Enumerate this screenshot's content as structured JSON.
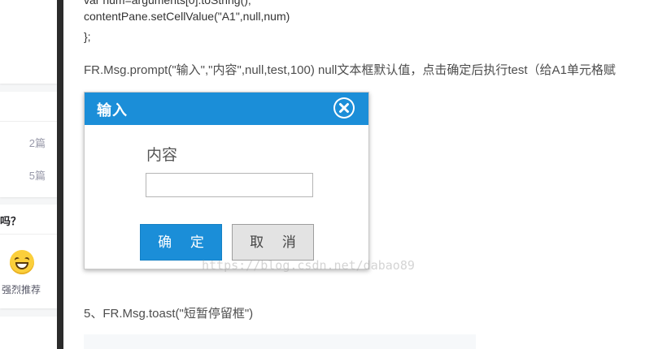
{
  "article": {
    "code_line_top": "var num=arguments[0].toString();",
    "code_line_1": "contentPane.setCellValue(\"A1\",null,num)",
    "code_line_2": "};",
    "description": "FR.Msg.prompt(\"输入\",\"内容\",null,test,100)  null文本框默认值，点击确定后执行test（给A1单元格赋",
    "section_5": "5、FR.Msg.toast(\"短暂停留框\")"
  },
  "dialog": {
    "title": "输入",
    "close_icon": "close-circle-icon",
    "prompt_label": "内容",
    "input_value": "",
    "ok_label": "确 定",
    "cancel_label": "取 消",
    "accent_color": "#1b8ed8"
  },
  "watermark": "https://blog.csdn.net/dabao89",
  "sidebar": {
    "counts": [
      "2篇",
      "5篇"
    ],
    "question": "吗？",
    "vote_label": "强烈推荐",
    "vote_icon": "laughing-face-icon"
  }
}
